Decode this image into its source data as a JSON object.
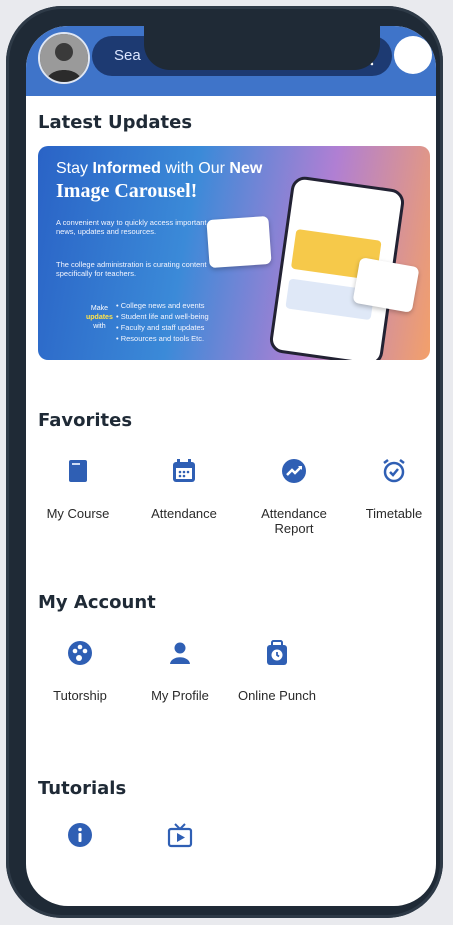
{
  "header": {
    "search_placeholder": "Sea",
    "icons": {
      "avatar": "user-photo",
      "search": "search-icon",
      "action": "circle-button"
    }
  },
  "latest_updates": {
    "title": "Latest Updates",
    "banner": {
      "line1_prefix": "Stay ",
      "line1_bold": "Informed",
      "line1_mid": " with Our ",
      "line1_new": "New",
      "line2": "Image Carousel!",
      "desc": "A convenient way to quickly access important news, updates and resources.",
      "desc2": "The college administration is curating content specifically for teachers.",
      "make_prefix": "Make",
      "make_highlight": "updates",
      "make_suffix": "with",
      "bullets": [
        "College news and events",
        "Student life and well-being",
        "Faculty and staff updates",
        "Resources and tools Etc."
      ]
    }
  },
  "favorites": {
    "title": "Favorites",
    "items": [
      {
        "label": "My Course",
        "icon": "book-icon"
      },
      {
        "label": "Attendance",
        "icon": "calendar-icon"
      },
      {
        "label": "Attendance Report",
        "icon": "trend-chart-icon"
      },
      {
        "label": "Timetable",
        "icon": "alarm-clock-icon"
      }
    ]
  },
  "my_account": {
    "title": "My Account",
    "items": [
      {
        "label": "Tutorship",
        "icon": "palette-icon"
      },
      {
        "label": "My Profile",
        "icon": "person-icon"
      },
      {
        "label": "Online Punch",
        "icon": "punch-clock-icon"
      }
    ]
  },
  "tutorials": {
    "title": "Tutorials",
    "items": [
      {
        "icon": "info-icon"
      },
      {
        "icon": "video-tv-icon"
      }
    ]
  },
  "colors": {
    "primary": "#3f74c9",
    "icon": "#2f5fb4",
    "text": "#1f2a36"
  }
}
